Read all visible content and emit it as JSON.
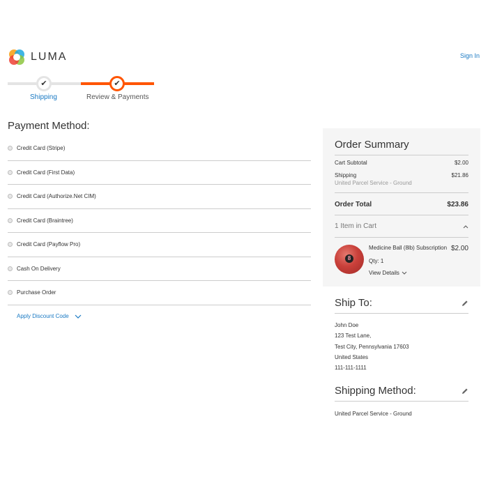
{
  "header": {
    "logo_text": "LUMA",
    "signin": "Sign In"
  },
  "progress": {
    "steps": [
      {
        "label": "Shipping",
        "state": "complete"
      },
      {
        "label": "Review & Payments",
        "state": "active"
      }
    ]
  },
  "payment": {
    "title": "Payment Method:",
    "methods": [
      "Credit Card (Stripe)",
      "Credit Card (First Data)",
      "Credit Card (Authorize.Net CIM)",
      "Credit Card (Braintree)",
      "Credit Card (Payflow Pro)",
      "Cash On Delivery",
      "Purchase Order"
    ],
    "discount_label": "Apply Discount Code"
  },
  "summary": {
    "title": "Order Summary",
    "subtotal_label": "Cart Subtotal",
    "subtotal_value": "$2.00",
    "shipping_label": "Shipping",
    "shipping_value": "$21.86",
    "shipping_carrier": "United Parcel Service - Ground",
    "total_label": "Order Total",
    "total_value": "$23.86",
    "cart_count_label": "1 Item in Cart",
    "item": {
      "name": "Medicine Ball (8lb) Subscription",
      "price": "$2.00",
      "qty": "Qty: 1",
      "details_label": "View Details",
      "ball_number": "8"
    }
  },
  "ship_to": {
    "title": "Ship To:",
    "name": "John Doe",
    "street": "123 Test Lane,",
    "city_line": "Test City, Pennsylvania 17603",
    "country": "United States",
    "phone": "111-111-1111"
  },
  "shipping_method": {
    "title": "Shipping Method:",
    "value": "United Parcel Service - Ground"
  },
  "colors": {
    "accent": "#ff5501",
    "link": "#1979c3",
    "sidebar_bg": "#f5f5f5"
  }
}
